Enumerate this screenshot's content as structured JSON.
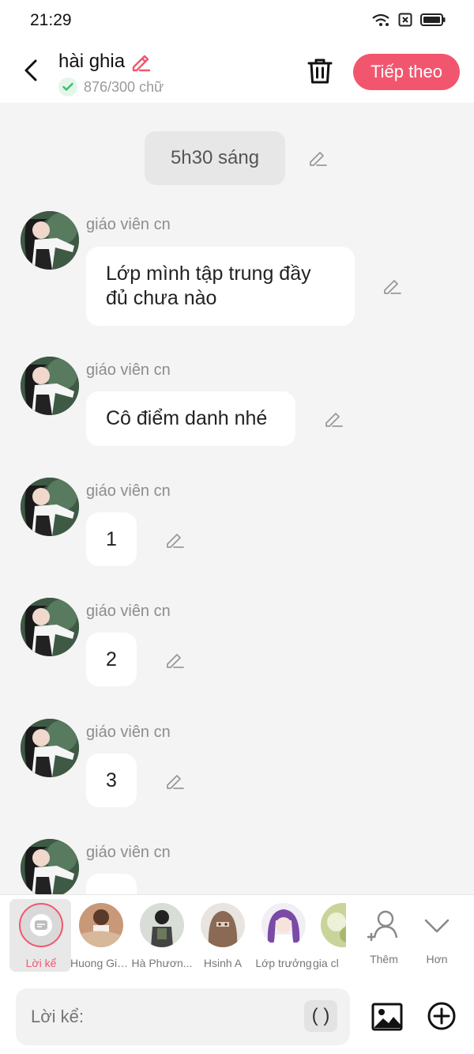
{
  "status": {
    "time": "21:29"
  },
  "header": {
    "title": "hài ghia",
    "word_count": "876/300 chữ",
    "next_label": "Tiếp theo"
  },
  "timestamp_chip": "5h30 sáng",
  "messages": [
    {
      "sender": "giáo viên cn",
      "text": "Lớp mình tập trung đầy đủ chưa nào"
    },
    {
      "sender": "giáo viên cn",
      "text": "Cô điểm danh nhé"
    },
    {
      "sender": "giáo viên cn",
      "text": "1"
    },
    {
      "sender": "giáo viên cn",
      "text": "2"
    },
    {
      "sender": "giáo viên cn",
      "text": "3"
    },
    {
      "sender": "giáo viên cn",
      "text": ""
    }
  ],
  "characters": [
    {
      "name": "Lời kể"
    },
    {
      "name": "Huong Gia..."
    },
    {
      "name": "Hà Phươn..."
    },
    {
      "name": "Hsinh A"
    },
    {
      "name": "Lớp trưởng"
    },
    {
      "name": "gia cl"
    }
  ],
  "tray_actions": {
    "add_label": "Thêm",
    "more_label": "Hơn"
  },
  "input": {
    "placeholder": "Lời kể:",
    "paren": "( )"
  },
  "colors": {
    "accent": "#f2566f",
    "bg": "#f4f4f4"
  }
}
